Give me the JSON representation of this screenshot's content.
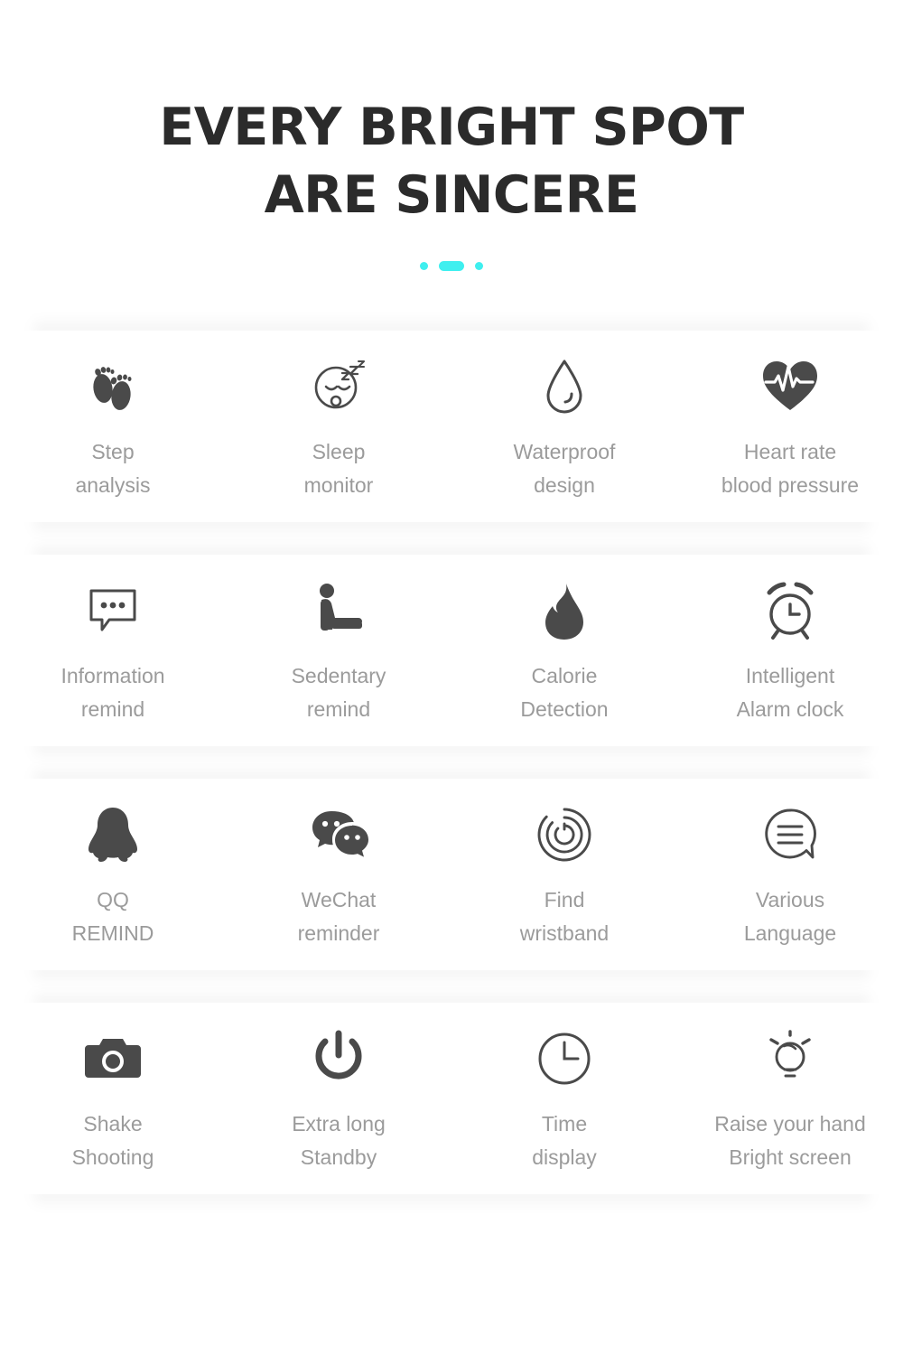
{
  "header": {
    "title_line1": "EVERY BRIGHT SPOT",
    "title_line2": "ARE SINCERE",
    "accent_color": "#3fefef",
    "title_color": "#2b2b2b",
    "decoration": [
      "dot",
      "pill",
      "dot"
    ]
  },
  "styles": {
    "label_color": "#9b9b9b",
    "icon_color": "#4a4a4a",
    "card_background": "#ffffff",
    "page_background": "#ffffff"
  },
  "features": {
    "rows": [
      {
        "items": [
          {
            "icon": "footprints-icon",
            "label": "Step\nanalysis"
          },
          {
            "icon": "sleeping-face-icon",
            "label": "Sleep\nmonitor"
          },
          {
            "icon": "water-drop-icon",
            "label": "Waterproof\ndesign"
          },
          {
            "icon": "heart-pulse-icon",
            "label": "Heart rate\nblood pressure"
          }
        ]
      },
      {
        "items": [
          {
            "icon": "chat-bubble-dots-icon",
            "label": "Information\nremind"
          },
          {
            "icon": "seated-person-icon",
            "label": "Sedentary\nremind"
          },
          {
            "icon": "flame-icon",
            "label": "Calorie\nDetection"
          },
          {
            "icon": "alarm-clock-icon",
            "label": "Intelligent\nAlarm clock"
          }
        ]
      },
      {
        "items": [
          {
            "icon": "qq-penguin-icon",
            "label": "QQ\nREMIND"
          },
          {
            "icon": "wechat-bubbles-icon",
            "label": "WeChat\nreminder"
          },
          {
            "icon": "radar-rings-icon",
            "label": "Find\nwristband"
          },
          {
            "icon": "speech-bubble-lines-icon",
            "label": "Various\nLanguage"
          }
        ]
      },
      {
        "items": [
          {
            "icon": "camera-icon",
            "label": "Shake\nShooting"
          },
          {
            "icon": "power-button-icon",
            "label": "Extra long\nStandby"
          },
          {
            "icon": "clock-icon",
            "label": "Time\ndisplay"
          },
          {
            "icon": "lightbulb-icon",
            "label": "Raise your hand\nBright screen"
          }
        ]
      }
    ]
  }
}
